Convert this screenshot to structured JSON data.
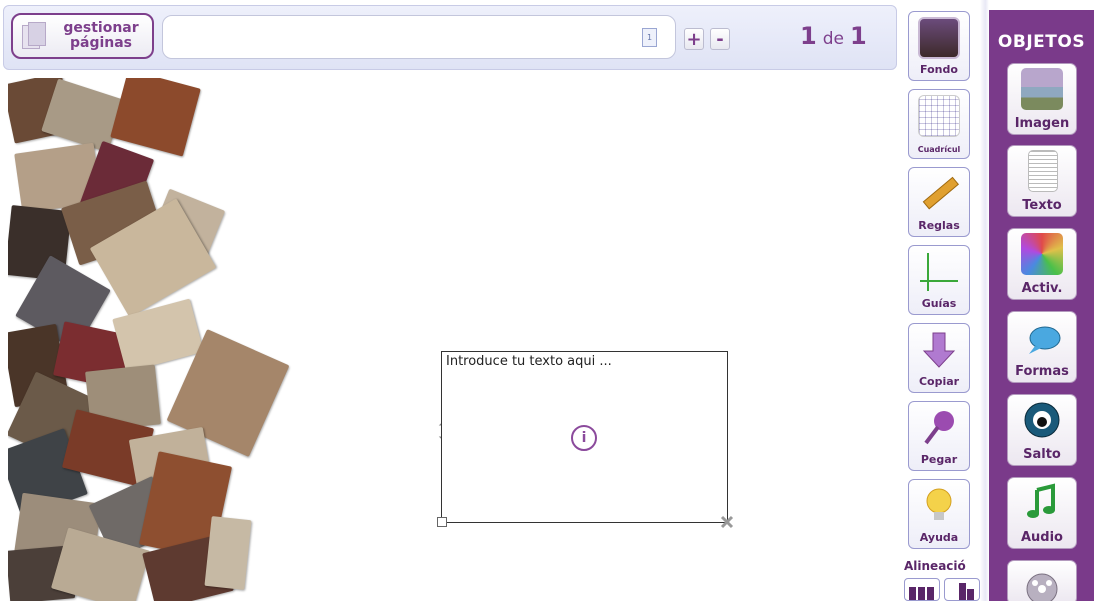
{
  "topbar": {
    "manage_pages_label": "gestionar páginas",
    "page_doc_icon_text": "1",
    "add_label": "+",
    "remove_label": "-",
    "page_current": "1",
    "page_of": "de",
    "page_total": "1"
  },
  "textbox": {
    "placeholder": "Introduce tu texto aqui ..."
  },
  "tools": [
    {
      "label": "Fondo",
      "icon": "picture-icon"
    },
    {
      "label": "Cuadrícul",
      "icon": "grid-icon"
    },
    {
      "label": "Reglas",
      "icon": "ruler-icon"
    },
    {
      "label": "Guías",
      "icon": "guides-icon"
    },
    {
      "label": "Copiar",
      "icon": "arrow-down-icon"
    },
    {
      "label": "Pegar",
      "icon": "pushpin-icon"
    },
    {
      "label": "Ayuda",
      "icon": "lightbulb-icon"
    }
  ],
  "alignment_label": "Alineació",
  "objects": {
    "title": "OBJETOS",
    "items": [
      {
        "label": "Imagen",
        "icon": "image-icon"
      },
      {
        "label": "Texto",
        "icon": "document-icon"
      },
      {
        "label": "Activ.",
        "icon": "activity-icon"
      },
      {
        "label": "Formas",
        "icon": "speech-bubble-icon"
      },
      {
        "label": "Salto",
        "icon": "jump-icon"
      },
      {
        "label": "Audio",
        "icon": "music-note-icon"
      },
      {
        "label": "",
        "icon": "film-reel-icon"
      }
    ]
  },
  "colors": {
    "accent": "#7d3f8c",
    "panel": "#7a3a8a"
  }
}
